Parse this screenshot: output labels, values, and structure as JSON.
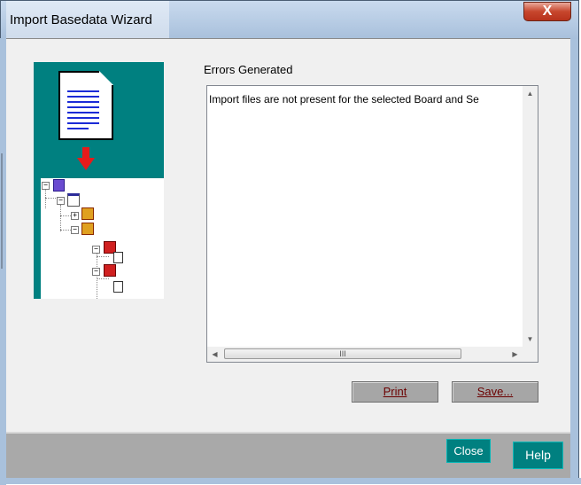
{
  "window": {
    "title": "Import Basedata Wizard",
    "close_glyph": "X"
  },
  "illustration": {
    "icons": [
      "document-icon",
      "down-arrow-icon",
      "tree-view-icon"
    ]
  },
  "errors": {
    "label": "Errors Generated",
    "lines": [
      "Import files are not present for the selected Board and Se"
    ]
  },
  "scroll": {
    "up": "▲",
    "down": "▼",
    "left": "◀",
    "right": "▶",
    "thumb_grip": "III"
  },
  "buttons": {
    "print": "Print",
    "save": "Save...",
    "close": "Close",
    "help": "Help"
  },
  "colors": {
    "accent_teal": "#008080",
    "close_red": "#c7462d"
  }
}
